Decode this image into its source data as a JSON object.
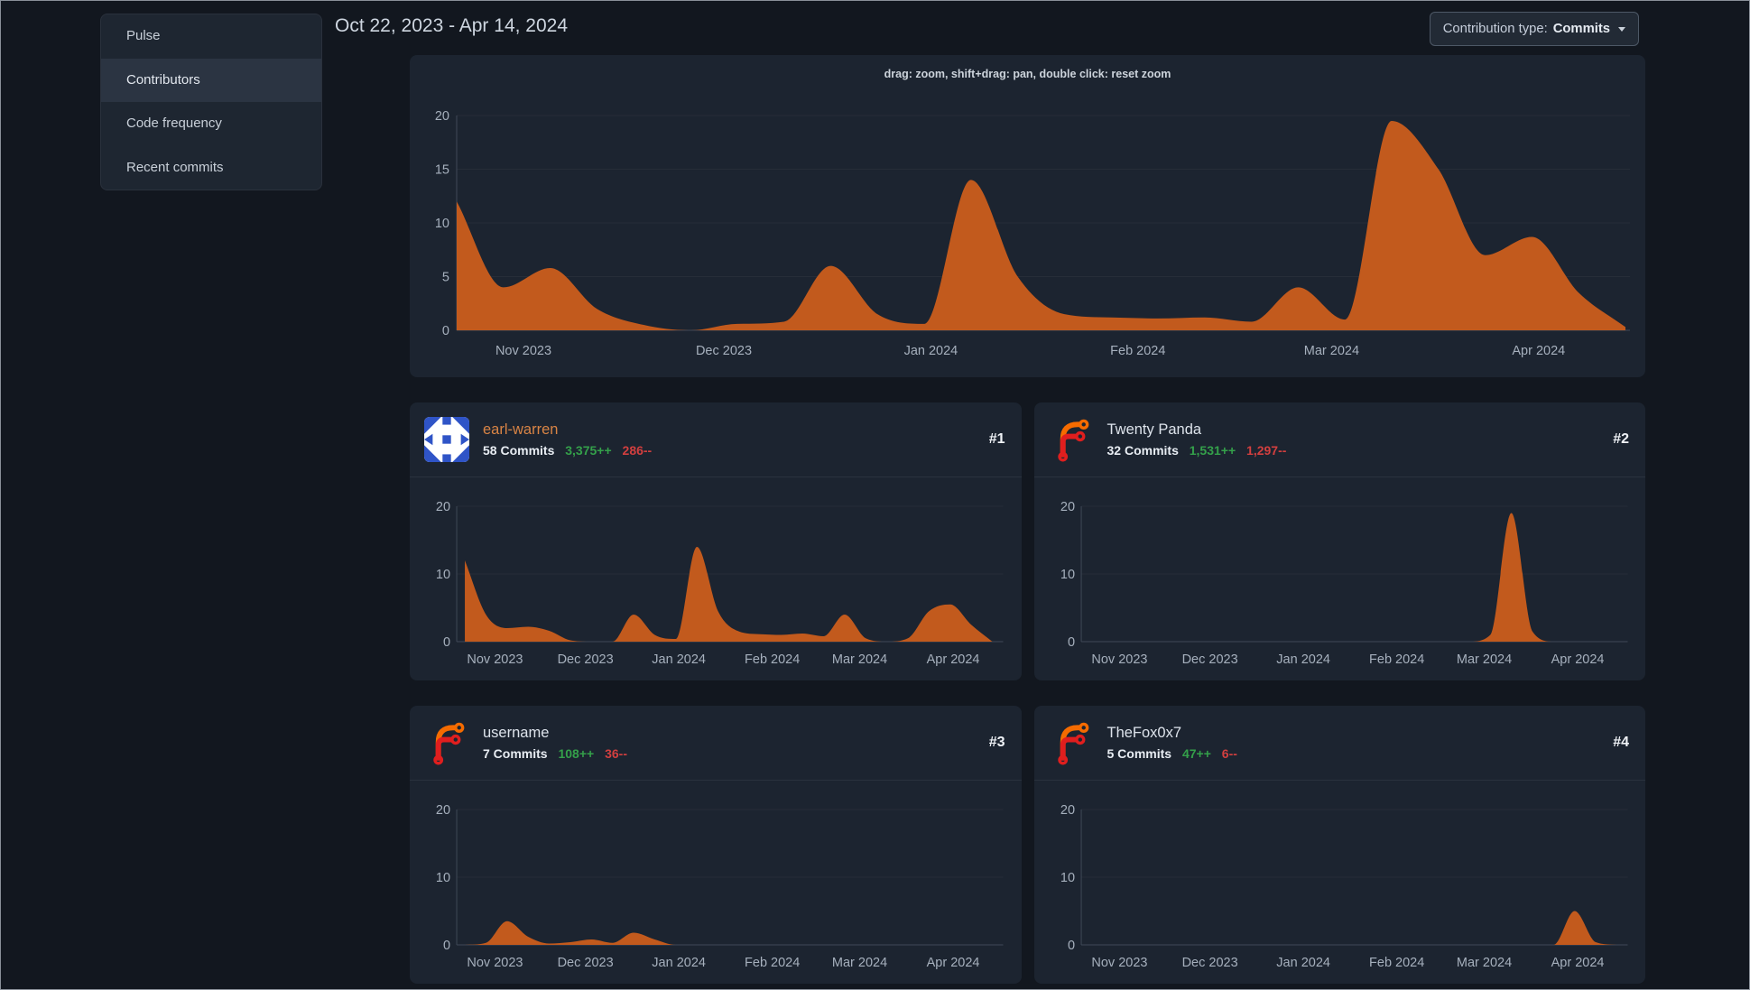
{
  "sidebar": {
    "items": [
      {
        "label": "Pulse",
        "active": false
      },
      {
        "label": "Contributors",
        "active": true
      },
      {
        "label": "Code frequency",
        "active": false
      },
      {
        "label": "Recent commits",
        "active": false
      }
    ]
  },
  "header": {
    "date_range": "Oct 22, 2023 - Apr 14, 2024",
    "contribution_dropdown": {
      "label": "Contribution type:",
      "value": "Commits"
    }
  },
  "main_chart": {
    "hint": "drag: zoom, shift+drag: pan, double click: reset zoom"
  },
  "contributors": [
    {
      "rank": "#1",
      "name": "earl-warren",
      "commits": "58 Commits",
      "additions": "3,375++",
      "deletions": "286--",
      "avatar": "blue-identicon",
      "name_is_link": true
    },
    {
      "rank": "#2",
      "name": "Twenty Panda",
      "commits": "32 Commits",
      "additions": "1,531++",
      "deletions": "1,297--",
      "avatar": "forgejo-logo",
      "name_is_link": false
    },
    {
      "rank": "#3",
      "name": "username",
      "commits": "7 Commits",
      "additions": "108++",
      "deletions": "36--",
      "avatar": "forgejo-logo",
      "name_is_link": false
    },
    {
      "rank": "#4",
      "name": "TheFox0x7",
      "commits": "5 Commits",
      "additions": "47++",
      "deletions": "6--",
      "avatar": "forgejo-logo",
      "name_is_link": false
    }
  ],
  "colors": {
    "area_orange": "#c25a1d",
    "additions_green": "#34a04a",
    "deletions_red": "#d23f3f",
    "link_orange": "#d98445",
    "panel_bg": "#1c2430",
    "page_bg": "#12171f"
  },
  "chart_data": {
    "type": "area",
    "x_axis": {
      "unit": "week",
      "start": "Oct 22, 2023",
      "end": "Apr 14, 2024",
      "total_days": 175,
      "tick_labels": [
        "Nov 2023",
        "Dec 2023",
        "Jan 2024",
        "Feb 2024",
        "Mar 2024",
        "Apr 2024"
      ],
      "tick_day_offsets": [
        10,
        40,
        71,
        102,
        131,
        162
      ]
    },
    "ylim": [
      0,
      20
    ],
    "grid": true,
    "legend": "none",
    "area_color": "#c25a1d",
    "charts": [
      {
        "name": "all-contributors",
        "title": "drag: zoom, shift+drag: pan, double click: reset zoom",
        "yticks": [
          0,
          5,
          10,
          15,
          20
        ],
        "weekly_values": [
          12,
          4,
          5.8,
          2,
          0.5,
          0,
          0.6,
          0.8,
          6,
          1.5,
          0.6,
          14,
          5,
          1.5,
          1.2,
          1.1,
          1.2,
          0.8,
          4,
          1,
          19.5,
          15,
          7,
          8.7,
          3.5,
          0.3
        ]
      },
      {
        "name": "earl-warren",
        "yticks": [
          0,
          10,
          20
        ],
        "weekly_values": [
          12,
          4,
          2,
          2.2,
          1.6,
          0.2,
          0,
          0,
          4,
          1,
          0.4,
          14,
          4.5,
          1.5,
          1.1,
          1,
          1.2,
          0.8,
          4,
          0.5,
          0,
          0.5,
          4.5,
          5.5,
          2.5,
          0
        ]
      },
      {
        "name": "Twenty Panda",
        "yticks": [
          0,
          10,
          20
        ],
        "weekly_values": [
          0,
          0,
          0,
          0,
          0,
          0,
          0,
          0,
          0,
          0,
          0,
          0,
          0,
          0,
          0,
          0,
          0,
          0,
          0,
          1,
          19,
          1.5,
          0,
          0,
          0,
          0
        ]
      },
      {
        "name": "username",
        "yticks": [
          0,
          10,
          20
        ],
        "weekly_values": [
          0,
          0.3,
          3.5,
          1.2,
          0.2,
          0.4,
          0.8,
          0.3,
          1.8,
          0.8,
          0,
          0,
          0,
          0,
          0,
          0,
          0,
          0,
          0,
          0,
          0,
          0,
          0,
          0,
          0,
          0
        ]
      },
      {
        "name": "TheFox0x7",
        "yticks": [
          0,
          10,
          20
        ],
        "weekly_values": [
          0,
          0,
          0,
          0,
          0,
          0,
          0,
          0,
          0,
          0,
          0,
          0,
          0,
          0,
          0,
          0,
          0,
          0,
          0,
          0,
          0,
          0,
          0,
          5,
          0.4,
          0
        ]
      }
    ]
  }
}
